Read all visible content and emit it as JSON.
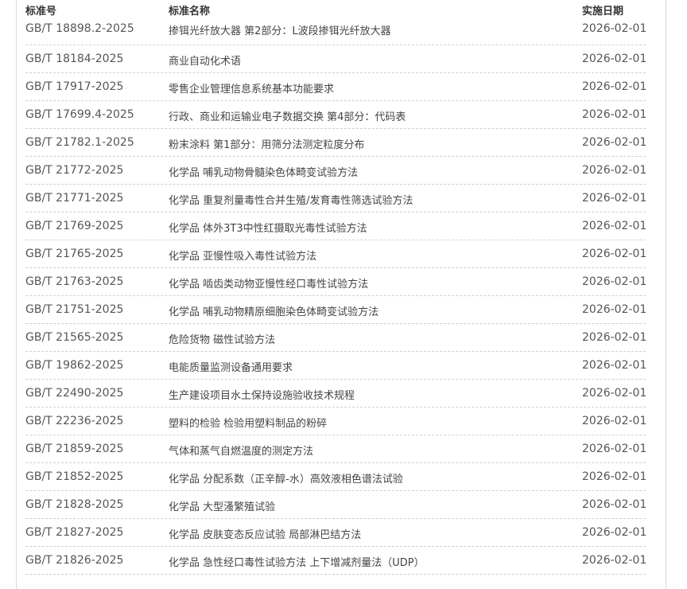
{
  "headers": {
    "code": "标准号",
    "name": "标准名称",
    "date": "实施日期"
  },
  "rows": [
    {
      "code": "GB/T 18898.2-2025",
      "name": "掺铒光纤放大器 第2部分：L波段掺铒光纤放大器",
      "date": "2026-02-01"
    },
    {
      "code": "GB/T 18184-2025",
      "name": "商业自动化术语",
      "date": "2026-02-01"
    },
    {
      "code": "GB/T 17917-2025",
      "name": "零售企业管理信息系统基本功能要求",
      "date": "2026-02-01"
    },
    {
      "code": "GB/T 17699.4-2025",
      "name": "行政、商业和运输业电子数据交换 第4部分：代码表",
      "date": "2026-02-01"
    },
    {
      "code": "GB/T 21782.1-2025",
      "name": "粉末涂料 第1部分：用筛分法测定粒度分布",
      "date": "2026-02-01"
    },
    {
      "code": "GB/T 21772-2025",
      "name": "化学品 哺乳动物骨髓染色体畸变试验方法",
      "date": "2026-02-01"
    },
    {
      "code": "GB/T 21771-2025",
      "name": "化学品 重复剂量毒性合并生殖/发育毒性筛选试验方法",
      "date": "2026-02-01"
    },
    {
      "code": "GB/T 21769-2025",
      "name": "化学品 体外3T3中性红摄取光毒性试验方法",
      "date": "2026-02-01"
    },
    {
      "code": "GB/T 21765-2025",
      "name": "化学品 亚慢性吸入毒性试验方法",
      "date": "2026-02-01"
    },
    {
      "code": "GB/T 21763-2025",
      "name": "化学品 啮齿类动物亚慢性经口毒性试验方法",
      "date": "2026-02-01"
    },
    {
      "code": "GB/T 21751-2025",
      "name": "化学品 哺乳动物精原细胞染色体畸变试验方法",
      "date": "2026-02-01"
    },
    {
      "code": "GB/T 21565-2025",
      "name": "危险货物 磁性试验方法",
      "date": "2026-02-01"
    },
    {
      "code": "GB/T 19862-2025",
      "name": "电能质量监测设备通用要求",
      "date": "2026-02-01"
    },
    {
      "code": "GB/T 22490-2025",
      "name": "生产建设项目水土保持设施验收技术规程",
      "date": "2026-02-01"
    },
    {
      "code": "GB/T 22236-2025",
      "name": "塑料的检验 检验用塑料制品的粉碎",
      "date": "2026-02-01"
    },
    {
      "code": "GB/T 21859-2025",
      "name": "气体和蒸气自燃温度的测定方法",
      "date": "2026-02-01"
    },
    {
      "code": "GB/T 21852-2025",
      "name": "化学品 分配系数（正辛醇-水）高效液相色谱法试验",
      "date": "2026-02-01"
    },
    {
      "code": "GB/T 21828-2025",
      "name": "化学品 大型溞繁殖试验",
      "date": "2026-02-01"
    },
    {
      "code": "GB/T 21827-2025",
      "name": "化学品 皮肤变态反应试验 局部淋巴结方法",
      "date": "2026-02-01"
    },
    {
      "code": "GB/T 21826-2025",
      "name": "化学品 急性经口毒性试验方法 上下增减剂量法（UDP）",
      "date": "2026-02-01"
    }
  ]
}
